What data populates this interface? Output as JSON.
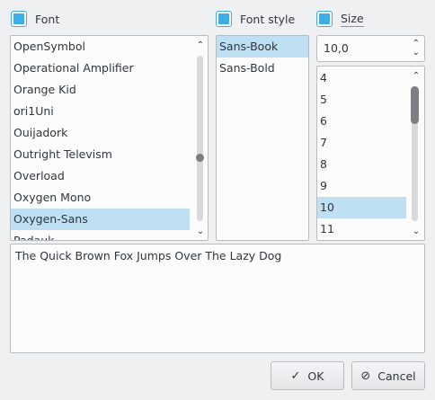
{
  "headers": {
    "font": "Font",
    "font_style": "Font style",
    "size": "Size"
  },
  "font_list": [
    "OpenSymbol",
    "Operational Amplifier",
    "Orange Kid",
    "ori1Uni",
    "Ouijadork",
    "Outright Televism",
    "Overload",
    "Oxygen Mono",
    "Oxygen-Sans",
    "Padauk"
  ],
  "font_list_selected": "Oxygen-Sans",
  "style_list": [
    "Sans-Book",
    "Sans-Bold"
  ],
  "style_list_selected": "Sans-Book",
  "size_value": "10,0",
  "size_list": [
    "4",
    "5",
    "6",
    "7",
    "8",
    "9",
    "10",
    "11"
  ],
  "size_list_selected": "10",
  "preview_text": "The Quick Brown Fox Jumps Over The Lazy Dog",
  "buttons": {
    "ok": "OK",
    "cancel": "Cancel"
  },
  "icons": {
    "checkbox": "checkbox-checked-icon",
    "ok": "check-icon",
    "cancel": "cancel-circle-icon",
    "up": "chevron-up-icon",
    "down": "chevron-down-icon"
  },
  "colors": {
    "accent": "#3daee9",
    "selection": "#bfdff3",
    "window": "#eff0f1",
    "field": "#fcfcfc"
  }
}
